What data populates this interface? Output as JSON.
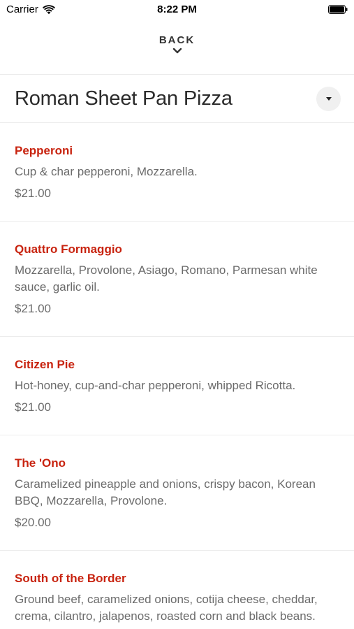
{
  "status_bar": {
    "carrier": "Carrier",
    "time": "8:22 PM",
    "wifi_icon": "wifi-icon",
    "battery_icon": "battery-icon"
  },
  "header": {
    "back_label": "BACK",
    "chevron_icon": "chevron-down-icon"
  },
  "category": {
    "title": "Roman Sheet Pan Pizza",
    "dropdown_icon": "caret-down-icon"
  },
  "colors": {
    "item_name": "#c8230f",
    "text_secondary": "#6b6b6b",
    "divider": "#ececec"
  },
  "menu": {
    "items": [
      {
        "name": "Pepperoni",
        "description": "Cup & char pepperoni, Mozzarella.",
        "price": "$21.00"
      },
      {
        "name": "Quattro Formaggio",
        "description": "Mozzarella, Provolone, Asiago, Romano, Parmesan white sauce, garlic oil.",
        "price": "$21.00"
      },
      {
        "name": "Citizen Pie",
        "description": "Hot-honey, cup-and-char pepperoni, whipped Ricotta.",
        "price": "$21.00"
      },
      {
        "name": "The 'Ono",
        "description": "Caramelized pineapple and onions, crispy bacon, Korean BBQ, Mozzarella, Provolone.",
        "price": "$20.00"
      },
      {
        "name": "South of the Border",
        "description": "Ground beef, caramelized onions, cotija cheese, cheddar, crema, cilantro, jalapenos, roasted corn and black beans.",
        "price": ""
      }
    ]
  }
}
